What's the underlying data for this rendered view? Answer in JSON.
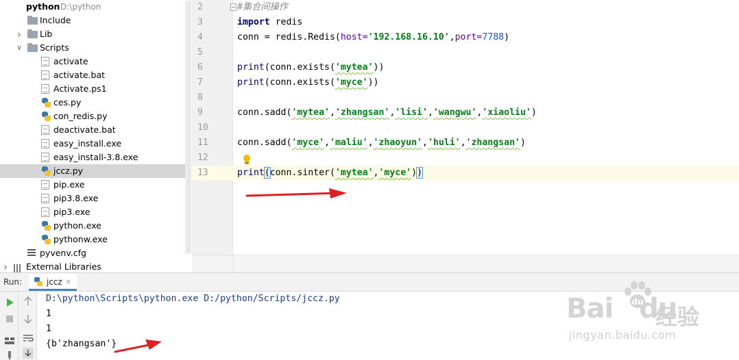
{
  "project": {
    "root_name": "python",
    "root_path": "D:\\python",
    "items": [
      {
        "label": "Include",
        "kind": "folder",
        "expandable": false
      },
      {
        "label": "Lib",
        "kind": "folder",
        "expandable": true,
        "expanded": false
      },
      {
        "label": "Scripts",
        "kind": "folder",
        "expandable": true,
        "expanded": true
      },
      {
        "label": "activate",
        "kind": "file"
      },
      {
        "label": "activate.bat",
        "kind": "file"
      },
      {
        "label": "Activate.ps1",
        "kind": "file"
      },
      {
        "label": "ces.py",
        "kind": "python"
      },
      {
        "label": "con_redis.py",
        "kind": "python"
      },
      {
        "label": "deactivate.bat",
        "kind": "file"
      },
      {
        "label": "easy_install.exe",
        "kind": "file"
      },
      {
        "label": "easy_install-3.8.exe",
        "kind": "file"
      },
      {
        "label": "jccz.py",
        "kind": "python",
        "selected": true
      },
      {
        "label": "pip.exe",
        "kind": "file"
      },
      {
        "label": "pip3.8.exe",
        "kind": "file"
      },
      {
        "label": "pip3.exe",
        "kind": "file"
      },
      {
        "label": "python.exe",
        "kind": "python"
      },
      {
        "label": "pythonw.exe",
        "kind": "python"
      },
      {
        "label": "pyvenv.cfg",
        "kind": "config"
      },
      {
        "label": "External Libraries",
        "kind": "libraries",
        "expandable": true,
        "expanded": false
      }
    ]
  },
  "editor": {
    "line_numbers": [
      "2",
      "3",
      "4",
      "5",
      "6",
      "7",
      "8",
      "9",
      "10",
      "11",
      "12",
      "13"
    ],
    "current_line": "13",
    "comment": "#集合间操作",
    "kw_import": "import",
    "module": "redis",
    "conn_prefix": "conn = redis.Redis(",
    "host_param": "host=",
    "host_value": "'192.168.16.10'",
    "port_param": "port=",
    "port_value": "7788",
    "close_paren": ")",
    "print_kw": "print",
    "exists_call": "(conn.exists(",
    "exists_arg1": "'mytea'",
    "exists_arg2": "'myce'",
    "exists_close": "))",
    "sadd_call": "conn.sadd(",
    "sadd1_args": [
      "'mytea'",
      "'zhangsan'",
      "'lisi'",
      "'wangwu'",
      "'xiaoliu'"
    ],
    "sadd2_args": [
      "'myce'",
      "'maliu'",
      "'zhaoyun'",
      "'huli'",
      "'zhangsan'"
    ],
    "comma": ",",
    "sinter_open": "(",
    "sinter_call": "conn.sinter(",
    "sinter_args": [
      "'mytea'",
      "'myce'"
    ],
    "sinter_close_inner": ")",
    "sinter_close_outer": ")"
  },
  "run": {
    "panel_label": "Run:",
    "tab_label": "jccz",
    "tab_close": "×",
    "output_lines": [
      "D:\\python\\Scripts\\python.exe D:/python/Scripts/jccz.py",
      "1",
      "1",
      "{b'zhangsan'}"
    ]
  },
  "watermark": {
    "logo_text": "Bai",
    "logo_text2": "du",
    "cn_text": "经验",
    "url": "jingyan.baidu.com"
  },
  "colors": {
    "keyword": "#000080",
    "string": "#067d17",
    "number": "#1750eb",
    "param": "#660099",
    "annotation_arrow": "#e02020",
    "selection": "#d5d5d5"
  }
}
